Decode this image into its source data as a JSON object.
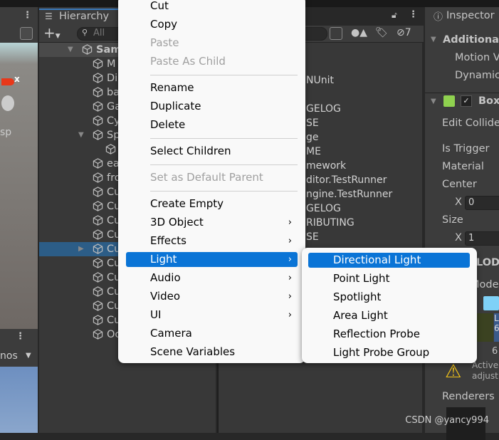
{
  "hierarchy": {
    "title": "Hierarchy",
    "search_placeholder": "All",
    "hidden_count": "7",
    "items": [
      {
        "label": "Sam"
      },
      {
        "label": "M"
      },
      {
        "label": "Di"
      },
      {
        "label": "ba"
      },
      {
        "label": "Ga"
      },
      {
        "label": "Cy"
      },
      {
        "label": "Sp"
      },
      {
        "label": ""
      },
      {
        "label": "ea"
      },
      {
        "label": "fro"
      },
      {
        "label": "Cu"
      },
      {
        "label": "Cu"
      },
      {
        "label": "Cu"
      },
      {
        "label": "Cu"
      },
      {
        "label": "Cu"
      },
      {
        "label": "Cu"
      },
      {
        "label": "Cu"
      },
      {
        "label": "Cu"
      },
      {
        "label": "Cu"
      },
      {
        "label": "Cu"
      },
      {
        "label": "Oc"
      }
    ]
  },
  "scene": {
    "axis_label": "x",
    "persp_label": "sp",
    "gizmos_label": "nos"
  },
  "middle_panel": {
    "lines": [
      "NUnit",
      "GELOG",
      "SE",
      "ge",
      "ME",
      "mework",
      "ditor.TestRunner",
      "ngine.TestRunner",
      "GELOG",
      "RIBUTING",
      "SE"
    ]
  },
  "inspector": {
    "title": "Inspector",
    "additional": "Additional",
    "motion": "Motion V",
    "dynamic": "Dynamic",
    "box": "Box",
    "edit_collider": "Edit Collide",
    "is_trigger": "Is Trigger",
    "material": "Material",
    "center": "Center",
    "center_x_label": "X",
    "center_x": "0",
    "size": "Size",
    "size_x_label": "X",
    "size_x": "1",
    "lod": "LOD",
    "mode": "Mode",
    "lod_label_1": "L",
    "lod_label_2": "6",
    "lod_value": "6",
    "warning": "Active",
    "warning2": "adjust",
    "renderers": "Renderers"
  },
  "context_menu": {
    "items": [
      {
        "label": "Cut",
        "enabled": true
      },
      {
        "label": "Copy",
        "enabled": true
      },
      {
        "label": "Paste",
        "enabled": false
      },
      {
        "label": "Paste As Child",
        "enabled": false
      },
      {
        "label": "Rename",
        "enabled": true
      },
      {
        "label": "Duplicate",
        "enabled": true
      },
      {
        "label": "Delete",
        "enabled": true
      },
      {
        "label": "Select Children",
        "enabled": true
      },
      {
        "label": "Set as Default Parent",
        "enabled": false
      },
      {
        "label": "Create Empty",
        "enabled": true
      },
      {
        "label": "3D Object",
        "submenu": true
      },
      {
        "label": "Effects",
        "submenu": true
      },
      {
        "label": "Light",
        "submenu": true,
        "highlighted": true
      },
      {
        "label": "Audio",
        "submenu": true
      },
      {
        "label": "Video",
        "submenu": true
      },
      {
        "label": "UI",
        "submenu": true
      },
      {
        "label": "Camera"
      },
      {
        "label": "Scene Variables"
      }
    ]
  },
  "light_submenu": {
    "items": [
      {
        "label": "Directional Light",
        "highlighted": true
      },
      {
        "label": "Point Light"
      },
      {
        "label": "Spotlight"
      },
      {
        "label": "Area Light"
      },
      {
        "label": "Reflection Probe"
      },
      {
        "label": "Light Probe Group"
      }
    ]
  },
  "watermark": "CSDN @yancy994",
  "colors": {
    "highlight": "#0a74d6",
    "selection": "#2c5d87",
    "panel": "#383838"
  }
}
